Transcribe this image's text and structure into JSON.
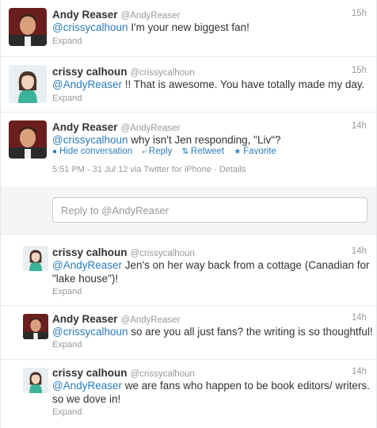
{
  "conversation": [
    {
      "user": "Andy Reaser",
      "handle": "@AndyReaser",
      "time": "15h",
      "mention": "@crissycalhoun",
      "text": " I'm your new biggest fan!",
      "expand": "Expand",
      "avatar_icon": "andy-avatar"
    },
    {
      "user": "crissy calhoun",
      "handle": "@crissycalhoun",
      "time": "15h",
      "mention": "@AndyReaser",
      "text": " !! That is awesome. You have totally made my day.",
      "expand": "Expand",
      "avatar_icon": "crissy-avatar"
    }
  ],
  "focused": {
    "user": "Andy Reaser",
    "handle": "@AndyReaser",
    "time": "14h",
    "mention": "@crissycalhoun",
    "text": " why isn't Jen responding, \"Liv\"?",
    "actions": {
      "hide": "Hide conversation",
      "reply": "Reply",
      "retweet": "Retweet",
      "favorite": "Favorite"
    },
    "meta": "5:51 PM - 31 Jul 12 via Twitter for iPhone · Details"
  },
  "reply_box": {
    "placeholder": "Reply to @AndyReaser"
  },
  "replies": [
    {
      "user": "crissy calhoun",
      "handle": "@crissycalhoun",
      "time": "14h",
      "mention": "@AndyReaser",
      "text_line1": " Jen's on her way back from a cottage (Canadian for",
      "text_line2": "\"lake house\")!",
      "expand": "Expand"
    },
    {
      "user": "Andy Reaser",
      "handle": "@AndyReaser",
      "time": "14h",
      "mention": "@crissycalhoun",
      "text_line1": " so are you all just fans? the writing is so thoughtful!",
      "expand": "Expand"
    },
    {
      "user": "crissy calhoun",
      "handle": "@crissycalhoun",
      "time": "14h",
      "mention": "@AndyReaser",
      "text_line1": " we are fans who happen to be book editors/ writers.",
      "text_line2": "so we dove in!",
      "expand": "Expand"
    }
  ],
  "colors": {
    "link": "#2b7bb9",
    "muted": "#999999",
    "text": "#333333"
  }
}
